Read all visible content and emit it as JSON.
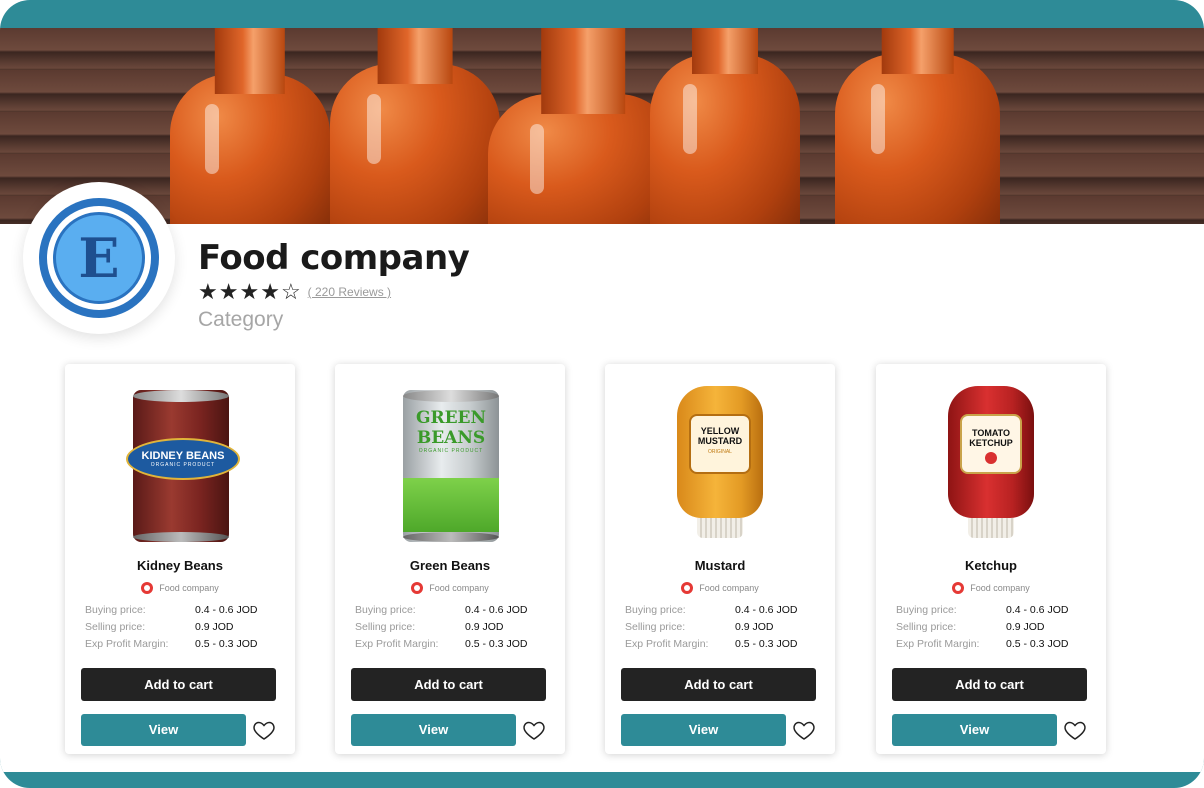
{
  "company": {
    "name": "Food company",
    "rating": 4,
    "max_rating": 5,
    "stars": [
      "★",
      "★",
      "★",
      "★",
      "☆"
    ],
    "reviews_text": "( 220 Reviews )",
    "category": "Category",
    "logo_letter": "E"
  },
  "colors": {
    "accent": "#2e8b97",
    "cart_button": "#232323",
    "logo_blue": "#2a73c0"
  },
  "labels": {
    "buying": "Buying price:",
    "selling": "Selling price:",
    "margin": "Exp Profit Margin:",
    "add_to_cart": "Add to cart",
    "view": "View"
  },
  "products": [
    {
      "name": "Kidney Beans",
      "vendor": "Food company",
      "buying": "0.4 - 0.6 JOD",
      "selling": "0.9 JOD",
      "margin": "0.5 - 0.3 JOD",
      "art_text": "KIDNEY BEANS",
      "art_sub": "ORGANIC PRODUCT"
    },
    {
      "name": "Green Beans",
      "vendor": "Food company",
      "buying": "0.4 - 0.6 JOD",
      "selling": "0.9 JOD",
      "margin": "0.5 - 0.3 JOD",
      "art_text": "GREEN BEANS",
      "art_sub": "ORGANIC PRODUCT"
    },
    {
      "name": "Mustard",
      "vendor": "Food company",
      "buying": "0.4 - 0.6 JOD",
      "selling": "0.9 JOD",
      "margin": "0.5 - 0.3 JOD",
      "art_text": "YELLOW MUSTARD",
      "art_sub": "ORIGINAL"
    },
    {
      "name": "Ketchup",
      "vendor": "Food company",
      "buying": "0.4 - 0.6 JOD",
      "selling": "0.9 JOD",
      "margin": "0.5 - 0.3 JOD",
      "art_text": "TOMATO KETCHUP",
      "art_sub": ""
    }
  ]
}
